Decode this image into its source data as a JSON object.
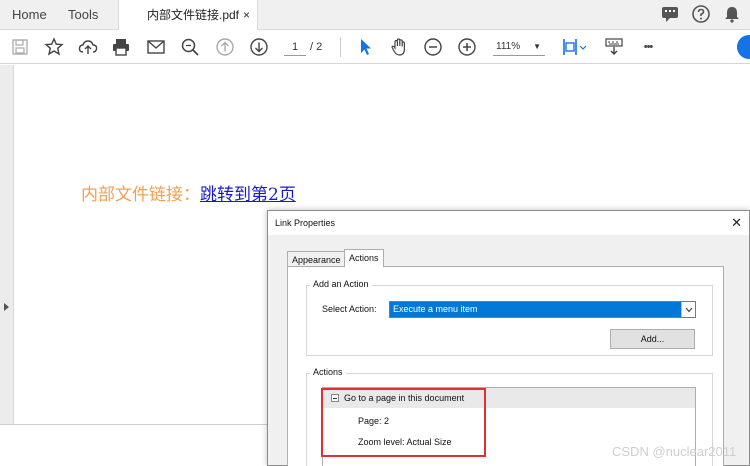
{
  "tabs": {
    "home": "Home",
    "tools": "Tools",
    "document": "内部文件链接.pdf",
    "close_glyph": "×"
  },
  "toolbar": {
    "page_current": "1",
    "page_total": "/ 2",
    "zoom": "111%",
    "zoom_arrow": "▼",
    "more_glyph": "•••"
  },
  "icons": {
    "save": "save-icon",
    "bookmark": "star-icon",
    "upload": "cloud-upload-icon",
    "print": "print-icon",
    "email": "mail-icon",
    "search": "search-icon",
    "page_up": "arrow-up-circle-icon",
    "page_down": "arrow-down-circle-icon",
    "select": "cursor-icon",
    "hand": "hand-icon",
    "zoom_out": "zoom-out-icon",
    "zoom_in": "zoom-in-icon",
    "fit": "fit-page-icon",
    "keyboard": "keyboard-icon",
    "more": "more-icon",
    "comment": "comment-icon",
    "help": "help-icon",
    "bell": "bell-icon"
  },
  "document": {
    "label": "内部文件链接：",
    "link_text": "跳转到第2页"
  },
  "dialog": {
    "title": "Link Properties",
    "close_glyph": "✕",
    "tabs": [
      "Appearance",
      "Actions"
    ],
    "add_action": {
      "group_label": "Add an Action",
      "select_label": "Select Action:",
      "select_value": "Execute a menu item",
      "add_button": "Add..."
    },
    "actions": {
      "group_label": "Actions",
      "root": "Go to a page in this document",
      "children": [
        "Page: 2",
        "Zoom level: Actual Size"
      ]
    }
  },
  "watermark": "CSDN @nuclear2011",
  "colors": {
    "accent": "#1473e6",
    "highlight": "#e03030",
    "select_bg": "#0078d7",
    "doc_label": "#f0a050",
    "doc_link": "#1a1acc"
  }
}
